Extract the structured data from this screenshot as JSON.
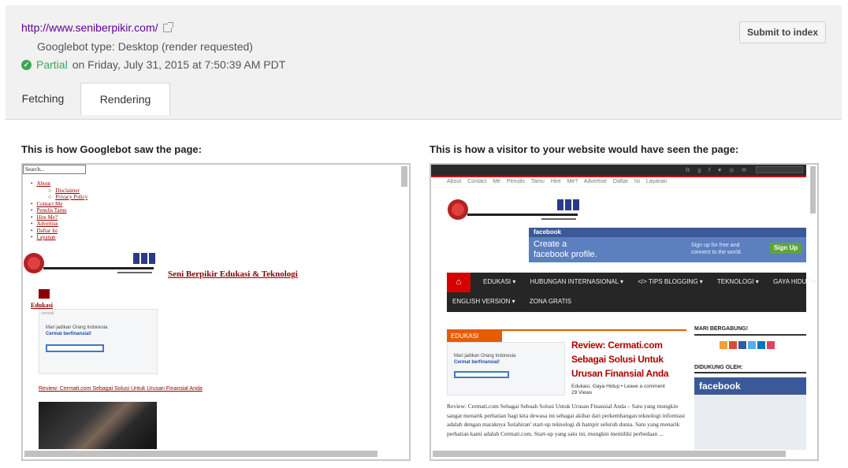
{
  "header": {
    "url": "http://www.seniberpikir.com/",
    "googlebot_type": "Googlebot type: Desktop (render requested)",
    "status_word": "Partial",
    "status_rest": "on Friday, July 31, 2015 at 7:50:39 AM PDT",
    "submit_label": "Submit to index"
  },
  "tabs": [
    {
      "label": "Fetching",
      "active": false
    },
    {
      "label": "Rendering",
      "active": true
    }
  ],
  "captions": {
    "googlebot": "This is how Googlebot saw the page:",
    "visitor": "This is how a visitor to your website would have seen the page:"
  },
  "googlebot_view": {
    "search_value": "Search...",
    "menu": [
      {
        "label": "About",
        "sub": false
      },
      {
        "label": "Disclaimer",
        "sub": true
      },
      {
        "label": "Privacy Policy",
        "sub": true
      },
      {
        "label": "Contact Me",
        "sub": false
      },
      {
        "label": "Penulis Tamu",
        "sub": false
      },
      {
        "label": "Hire Me?",
        "sub": false
      },
      {
        "label": "Advertise",
        "sub": false
      },
      {
        "label": "Daftar Isi",
        "sub": false
      },
      {
        "label": "Layanan",
        "sub": false
      }
    ],
    "site_title": "Seni Berpikir Edukasi & Teknologi",
    "category": "Edukasi",
    "thumb_brand": "cermati",
    "thumb_line1": "Mari jadikan Orang Indonesia",
    "thumb_line2": "Cermat berfinansial!",
    "review_link": "Review: Cermati.com Sebagai Solusi Untuk Urusan Finansial Anda"
  },
  "visitor_view": {
    "top_menu": "About Contact Me Penulis Tamu Hire Me? Advertise Daftar Isi Layanan",
    "fb_brand": "facebook",
    "fb_create_1": "Create a",
    "fb_create_2": "facebook profile.",
    "fb_signup_text_1": "Sign up for free and",
    "fb_signup_text_2": "connect to the world.",
    "fb_signup_button": "Sign Up",
    "nav_row1": [
      "EDUKASI ▾",
      "HUBUNGAN INTERNASIONAL ▾",
      "</> TIPS BLOGGING ▾",
      "TEKNOLOGI ▾",
      "GAYA HIDUP ▾"
    ],
    "nav_row2": [
      "ENGLISH VERSION ▾",
      "ZONA GRATIS"
    ],
    "category": "EDUKASI",
    "headline": "Review: Cermati.com Sebagai Solusi Untuk Urusan Finansial Anda",
    "meta_tags": "Edukasi, Gaya Hidup",
    "meta_comment": "Leave a comment",
    "meta_views": "29 Views",
    "excerpt": "Review: Cermati.com Sebagai Sebuah Solusi Untuk Urusan Finansial Anda – Satu yang mungkin sangat menarik perhatian bagi kita dewasa ini sebagai akibat dari perkembangan teknologi informasi adalah dengan maraknya 'kelahiran' start-up teknologi di hampir seluruh dunia. Satu yang menarik perhatian kami adalah Cermati.com. Start-up yang satu ini, mungkin memiliki perbedaan ...",
    "side_join": "MARI BERGABUNG!",
    "side_support": "DIDUKUNG OLEH:",
    "side_fb": "facebook",
    "social_colors": [
      "#f0a030",
      "#dd4b39",
      "#3b5998",
      "#55acee",
      "#0077b5",
      "#e4405f"
    ]
  }
}
